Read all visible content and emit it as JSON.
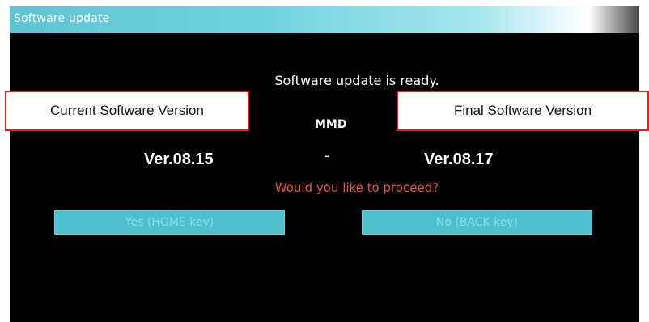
{
  "window": {
    "title": "Software update"
  },
  "dialog": {
    "message": "Software update is ready.",
    "component": "MMD",
    "separator": "-",
    "question": "Would you like to proceed?"
  },
  "annotations": {
    "current_label": "Current Software Version",
    "final_label": "Final Software Version"
  },
  "versions": {
    "current": "Ver.08.15",
    "final": "Ver.08.17"
  },
  "buttons": {
    "yes": "Yes (HOME key)",
    "no": "No (BACK key)"
  },
  "colors": {
    "screen_bg": "#000000",
    "title_bar": "#5fc3d1",
    "question_text": "#e85530",
    "button_bg": "#4cc0cf",
    "annotation_border": "#e02020"
  }
}
